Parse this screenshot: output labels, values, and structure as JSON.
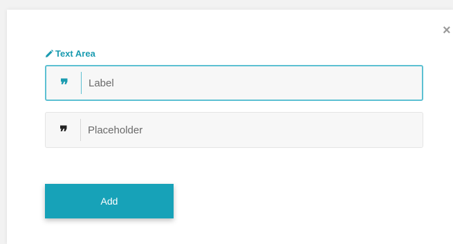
{
  "dialog": {
    "close_symbol": "×",
    "section_title": "Text Area",
    "section_icon": "pencil-icon"
  },
  "fields": {
    "label": {
      "icon": "quote-icon",
      "glyph": "❞",
      "placeholder": "Label",
      "value": ""
    },
    "placeholder": {
      "icon": "quote-icon",
      "glyph": "❞",
      "placeholder": "Placeholder",
      "value": ""
    }
  },
  "actions": {
    "add_label": "Add"
  },
  "colors": {
    "accent": "#17a2b8",
    "title": "#1a9bb0",
    "focus_border": "#5cc0d2"
  }
}
